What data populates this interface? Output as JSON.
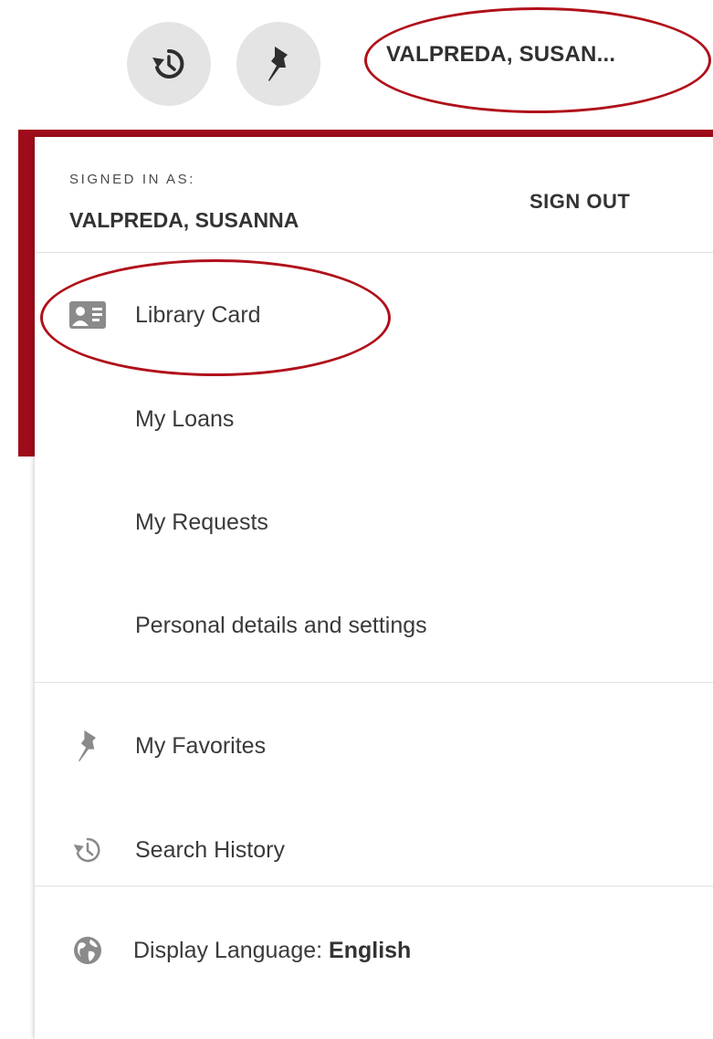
{
  "toolbar": {
    "history_icon": "history-icon",
    "pin_icon": "pushpin-icon",
    "user_short": "VALPREDA, SUSAN..."
  },
  "panel": {
    "signed_in_label": "SIGNED IN AS:",
    "user_full": "VALPREDA, SUSANNA",
    "sign_out": "SIGN OUT",
    "items": [
      {
        "label": "Library Card",
        "icon": "id-card-icon"
      },
      {
        "label": "My Loans"
      },
      {
        "label": "My Requests"
      },
      {
        "label": "Personal details and settings"
      },
      {
        "label": "My Favorites",
        "icon": "pushpin-icon"
      },
      {
        "label": "Search History",
        "icon": "history-icon"
      }
    ],
    "language": {
      "prefix": "Display Language:",
      "value": "English",
      "icon": "globe-icon"
    }
  },
  "colors": {
    "accent_red": "#9e0c1b",
    "annotation_red": "#b0101a",
    "button_gray": "#e4e4e4",
    "icon_gray": "#8a8a8a"
  }
}
